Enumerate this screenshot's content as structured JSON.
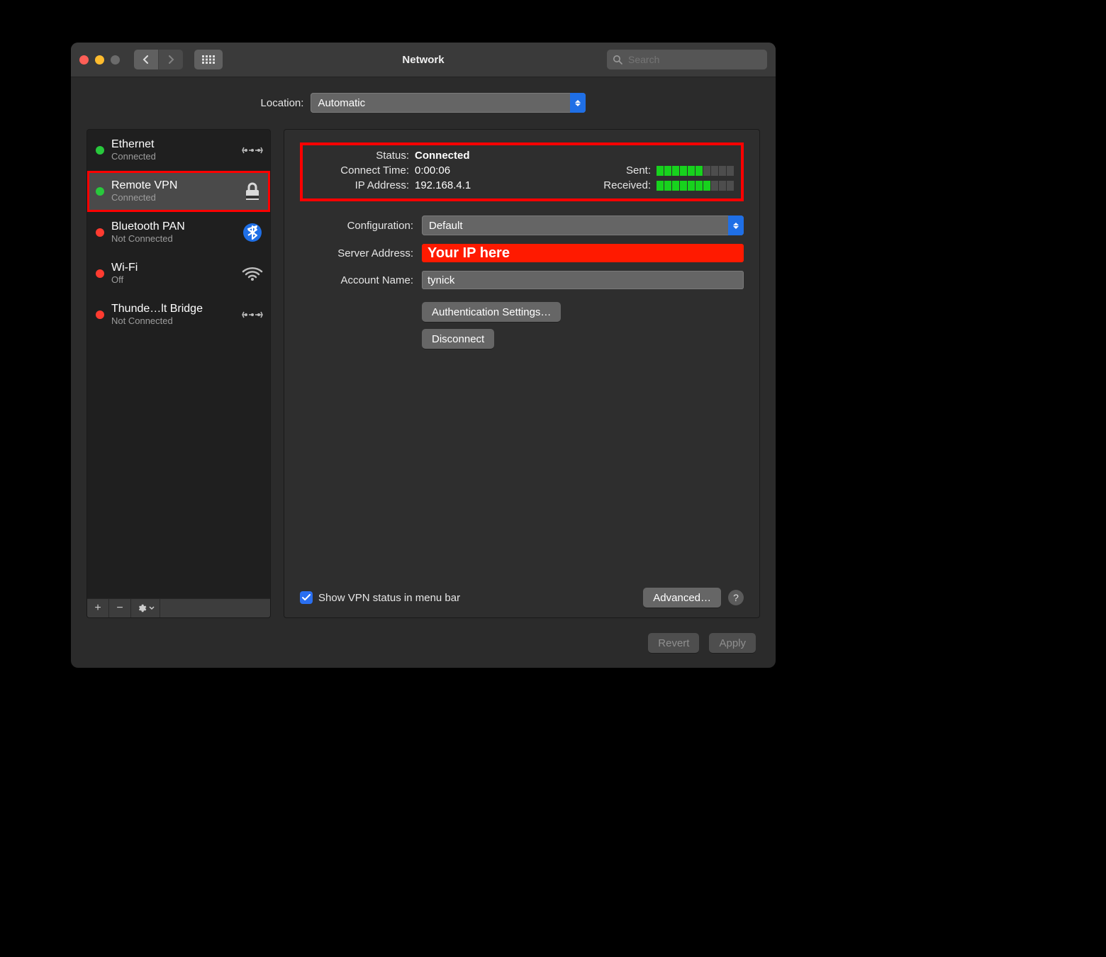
{
  "window": {
    "title": "Network"
  },
  "toolbar": {
    "search_placeholder": "Search"
  },
  "location": {
    "label": "Location:",
    "value": "Automatic"
  },
  "sidebar": {
    "services": [
      {
        "name": "Ethernet",
        "status": "Connected",
        "dot": "green",
        "icon": "ethernet",
        "selected": false
      },
      {
        "name": "Remote VPN",
        "status": "Connected",
        "dot": "green",
        "icon": "lock",
        "selected": true,
        "highlighted": true
      },
      {
        "name": "Bluetooth PAN",
        "status": "Not Connected",
        "dot": "red",
        "icon": "bluetooth",
        "selected": false
      },
      {
        "name": "Wi-Fi",
        "status": "Off",
        "dot": "red",
        "icon": "wifi",
        "selected": false
      },
      {
        "name": "Thunde…lt Bridge",
        "status": "Not Connected",
        "dot": "red",
        "icon": "ethernet",
        "selected": false
      }
    ],
    "buttons": {
      "add": "+",
      "remove": "−",
      "gear": "⚙︎"
    }
  },
  "status": {
    "status_label": "Status:",
    "status_value": "Connected",
    "connect_time_label": "Connect Time:",
    "connect_time_value": "0:00:06",
    "ip_label": "IP Address:",
    "ip_value": "192.168.4.1",
    "sent_label": "Sent:",
    "received_label": "Received:",
    "sent_level": 6,
    "received_level": 7
  },
  "form": {
    "config_label": "Configuration:",
    "config_value": "Default",
    "server_label": "Server Address:",
    "server_value": "Your IP here",
    "account_label": "Account Name:",
    "account_value": "tynick",
    "auth_button": "Authentication Settings…",
    "disconnect_button": "Disconnect",
    "show_menu_label": "Show VPN status in menu bar",
    "show_menu_checked": true,
    "advanced_button": "Advanced…"
  },
  "footer": {
    "revert": "Revert",
    "apply": "Apply"
  }
}
